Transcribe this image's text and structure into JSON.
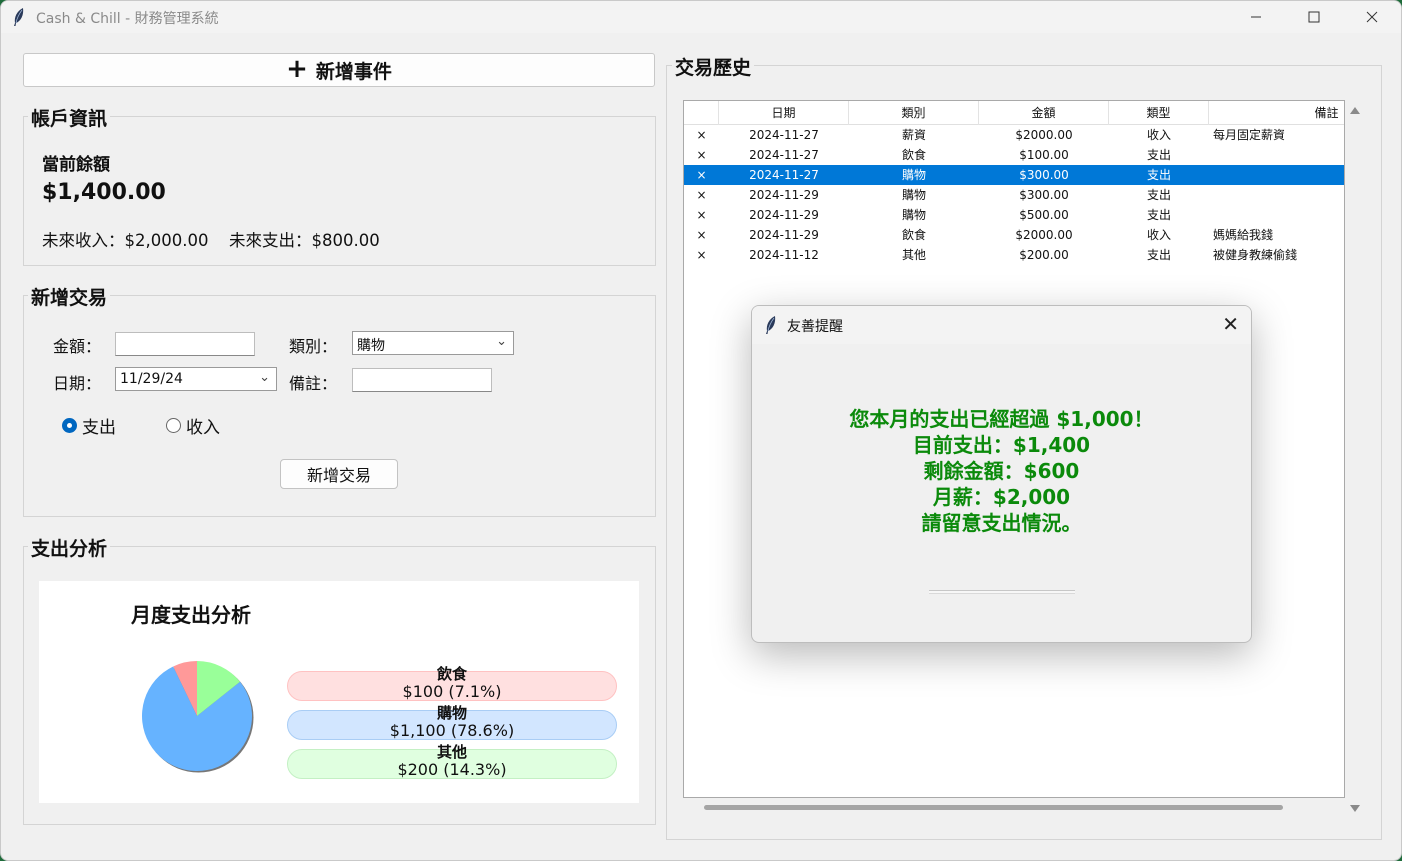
{
  "window": {
    "title": "Cash & Chill - 財務管理系統"
  },
  "left": {
    "add_event_icon": "+",
    "add_event_label": "新增事件",
    "account": {
      "title": "帳戶資訊",
      "balance_label": "當前餘額",
      "balance_value": "$1,400.00",
      "future_income": "未來收入：$2,000.00",
      "future_expense": "未來支出：$800.00"
    },
    "new_tx": {
      "title": "新增交易",
      "amount_label": "金額：",
      "amount_value": "",
      "category_label": "類別：",
      "category_value": "購物",
      "date_label": "日期：",
      "date_value": "11/29/24",
      "note_label": "備註：",
      "note_value": "",
      "radio_expense": "支出",
      "radio_income": "收入",
      "radio_selected": "expense",
      "submit_label": "新增交易"
    },
    "analysis": {
      "title": "支出分析"
    }
  },
  "chart_data": {
    "type": "pie",
    "title": "月度支出分析",
    "slices": [
      {
        "name": "飲食",
        "value": 100,
        "label": "$100 (7.1%)",
        "color": "#ff9999"
      },
      {
        "name": "購物",
        "value": 1100,
        "label": "$1,100 (78.6%)",
        "color": "#66b3ff"
      },
      {
        "name": "其他",
        "value": 200,
        "label": "$200 (14.3%)",
        "color": "#99ff99"
      }
    ]
  },
  "history": {
    "title": "交易歷史",
    "columns": [
      "日期",
      "類別",
      "金額",
      "類型",
      "備註"
    ],
    "rows": [
      {
        "del": "×",
        "date": "2024-11-27",
        "cat": "薪資",
        "amt": "$2000.00",
        "type": "收入",
        "note": "每月固定薪資"
      },
      {
        "del": "×",
        "date": "2024-11-27",
        "cat": "飲食",
        "amt": "$100.00",
        "type": "支出",
        "note": ""
      },
      {
        "del": "×",
        "date": "2024-11-27",
        "cat": "購物",
        "amt": "$300.00",
        "type": "支出",
        "note": ""
      },
      {
        "del": "×",
        "date": "2024-11-29",
        "cat": "購物",
        "amt": "$300.00",
        "type": "支出",
        "note": ""
      },
      {
        "del": "×",
        "date": "2024-11-29",
        "cat": "購物",
        "amt": "$500.00",
        "type": "支出",
        "note": ""
      },
      {
        "del": "×",
        "date": "2024-11-29",
        "cat": "飲食",
        "amt": "$2000.00",
        "type": "收入",
        "note": "媽媽給我錢"
      },
      {
        "del": "×",
        "date": "2024-11-12",
        "cat": "其他",
        "amt": "$200.00",
        "type": "支出",
        "note": "被健身教練偷錢"
      }
    ],
    "selected_row": 2
  },
  "dialog": {
    "title": "友善提醒",
    "lines": [
      "您本月的支出已經超過 $1,000！",
      "目前支出：$1,400",
      "剩餘金額：$600",
      "月薪：$2,000",
      "請留意支出情況。"
    ],
    "message_color": "#0b8a0b"
  }
}
